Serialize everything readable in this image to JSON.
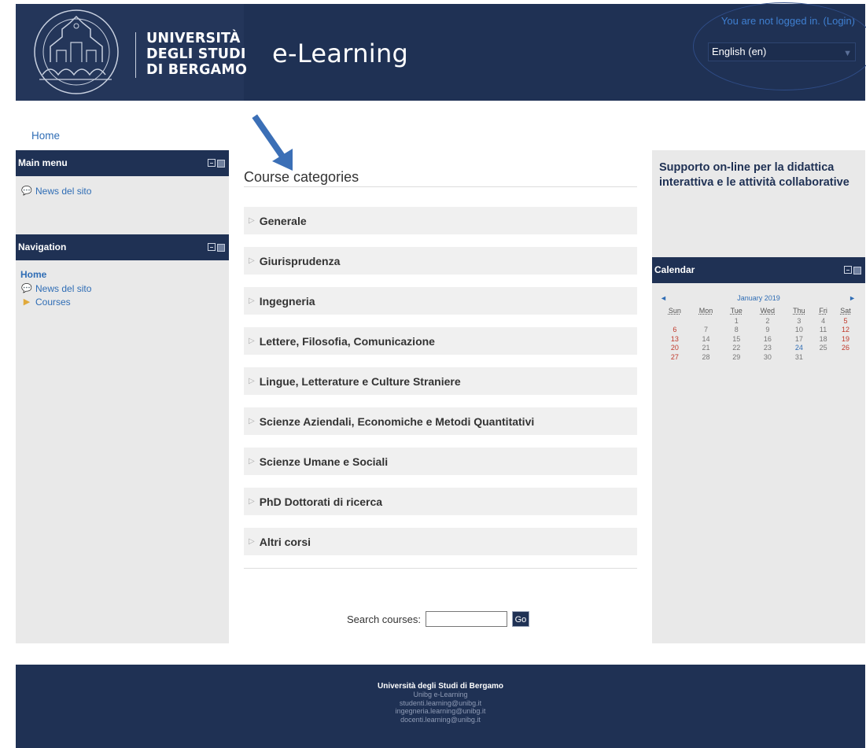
{
  "header": {
    "brand_lines": [
      "UNIVERSITÀ",
      "DEGLI STUDI",
      "DI BERGAMO"
    ],
    "site_title": "e-Learning",
    "login_text": "You are not logged in. (Login)",
    "language": "English (en)"
  },
  "breadcrumb": {
    "home": "Home"
  },
  "main_menu": {
    "title": "Main menu",
    "items": [
      {
        "label": "News del sito",
        "icon": "speech-bubble-icon"
      }
    ]
  },
  "navigation": {
    "title": "Navigation",
    "home": "Home",
    "items": [
      {
        "label": "News del sito",
        "icon": "speech-bubble-icon"
      },
      {
        "label": "Courses",
        "icon": "triangle-right-icon"
      }
    ]
  },
  "main": {
    "heading": "Course categories",
    "categories": [
      "Generale",
      "Giurisprudenza",
      "Ingegneria",
      "Lettere, Filosofia, Comunicazione",
      "Lingue, Letterature e Culture Straniere",
      "Scienze Aziendali, Economiche e Metodi Quantitativi",
      "Scienze Umane e Sociali",
      "PhD Dottorati di ricerca",
      "Altri corsi"
    ],
    "search_label": "Search courses:",
    "search_value": "",
    "go_label": "Go"
  },
  "right": {
    "support_text": "Supporto on-line per la didattica interattiva e le attività collaborative",
    "calendar": {
      "title": "Calendar",
      "month": "January 2019",
      "prev": "◄",
      "next": "►",
      "days": [
        "Sun",
        "Mon",
        "Tue",
        "Wed",
        "Thu",
        "Fri",
        "Sat"
      ],
      "weeks": [
        [
          "",
          "",
          "1",
          "2",
          "3",
          "4",
          "5"
        ],
        [
          "6",
          "7",
          "8",
          "9",
          "10",
          "11",
          "12"
        ],
        [
          "13",
          "14",
          "15",
          "16",
          "17",
          "18",
          "19"
        ],
        [
          "20",
          "21",
          "22",
          "23",
          "24",
          "25",
          "26"
        ],
        [
          "27",
          "28",
          "29",
          "30",
          "31",
          "",
          ""
        ]
      ],
      "today": "24"
    }
  },
  "footer": {
    "lines": [
      "Università degli Studi di Bergamo",
      "Unibg e-Learning",
      "studenti.learning@unibg.it",
      "ingegneria.learning@unibg.it",
      "docenti.learning@unibg.it"
    ]
  },
  "colors": {
    "navy": "#1f3154",
    "link": "#2f6db5",
    "panel_gray": "#e9e9e9",
    "weekend_red": "#c0392b"
  }
}
